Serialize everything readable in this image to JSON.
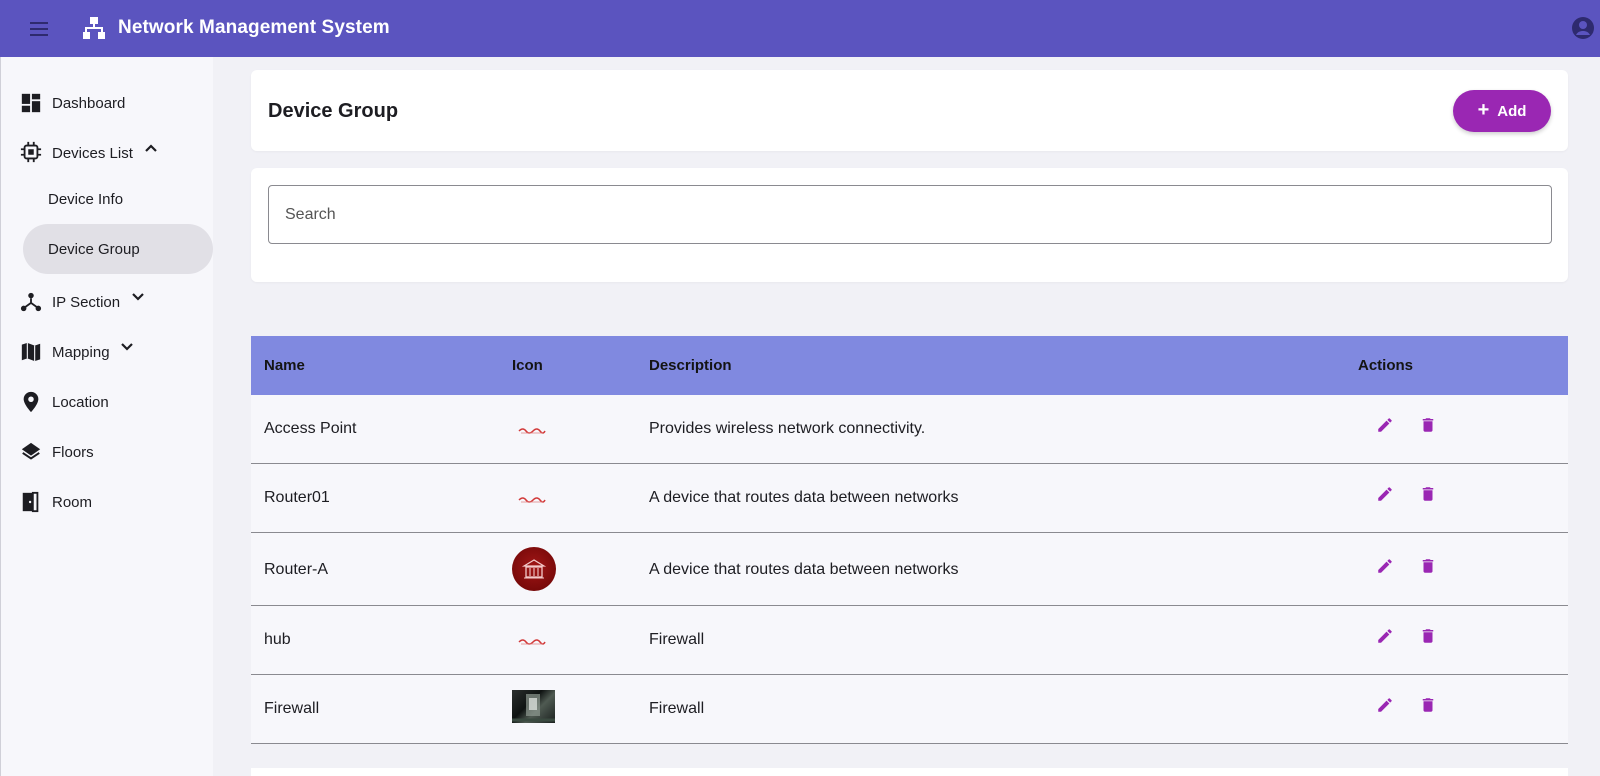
{
  "app": {
    "title": "Network Management System",
    "colors": {
      "header": "#5b54bf",
      "accent": "#9a27b3",
      "table_header": "#8089e0"
    }
  },
  "sidebar": {
    "items": [
      {
        "label": "Dashboard",
        "icon": "dashboard-icon"
      },
      {
        "label": "Devices List",
        "icon": "chip-icon",
        "expanded": true
      },
      {
        "label": "Device Info"
      },
      {
        "label": "Device Group",
        "active": true
      },
      {
        "label": "IP Section",
        "icon": "hub-icon",
        "expanded": false
      },
      {
        "label": "Mapping",
        "icon": "map-icon",
        "expanded": false
      },
      {
        "label": "Location",
        "icon": "location-pin-icon"
      },
      {
        "label": "Floors",
        "icon": "layers-icon"
      },
      {
        "label": "Room",
        "icon": "door-icon"
      }
    ]
  },
  "page": {
    "title": "Device Group",
    "add_label": "Add",
    "search_placeholder": "Search"
  },
  "table": {
    "headers": [
      "Name",
      "Icon",
      "Description",
      "Actions"
    ],
    "rows": [
      {
        "name": "Access Point",
        "icon": "small-red-graphic",
        "description": "Provides wireless network connectivity."
      },
      {
        "name": "Router01",
        "icon": "small-red-graphic",
        "description": "A device that routes data between networks"
      },
      {
        "name": "Router-A",
        "icon": "red-circle-building",
        "description": "A device that routes data between networks"
      },
      {
        "name": "hub",
        "icon": "small-red-graphic",
        "description": "Firewall"
      },
      {
        "name": "Firewall",
        "icon": "dark-photo",
        "description": "Firewall"
      }
    ]
  }
}
